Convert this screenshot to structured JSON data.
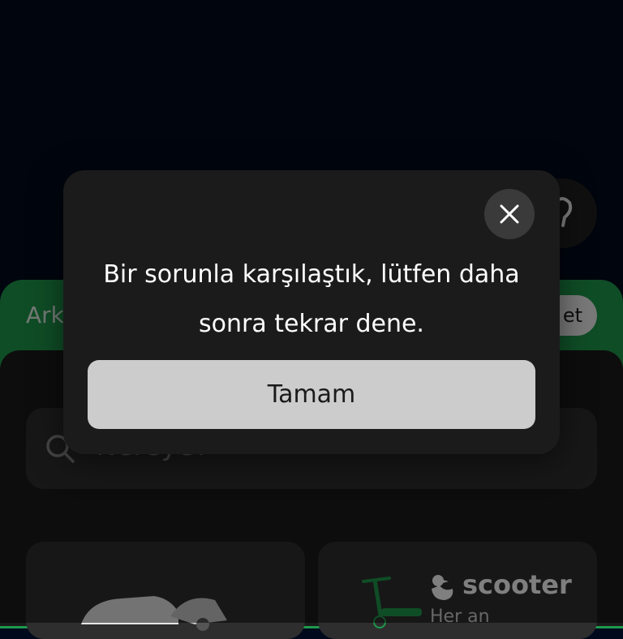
{
  "background_screen": {
    "panel_label_partial": "Ark",
    "pill_partial": "et",
    "search": {
      "placeholder": "Nereye?"
    },
    "tiles": {
      "scooter": {
        "title": "scooter",
        "subtitle_partial": "Her an"
      }
    },
    "icons": [
      "question-icon",
      "search-icon",
      "car-image",
      "scooter-image",
      "duck-icon"
    ]
  },
  "dialog": {
    "message": "Bir sorunla karşılaştık, lütfen daha sonra tekrar dene.",
    "ok_label": "Tamam",
    "close_icon": "close-icon"
  },
  "colors": {
    "app_background": "#000a1c",
    "brand_green": "#1e9a4d",
    "dialog_background": "#1b1b1b",
    "button_background": "#cccccc"
  }
}
